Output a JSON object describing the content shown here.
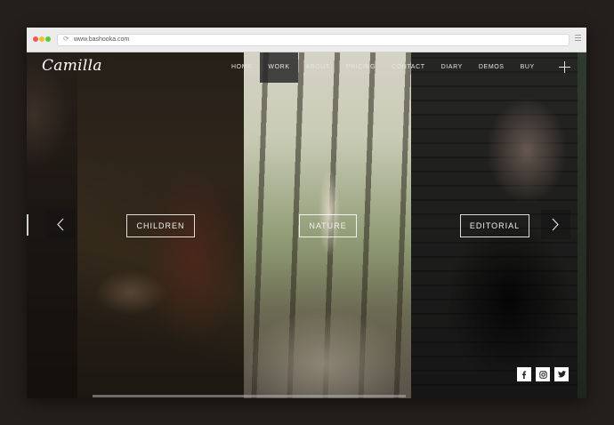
{
  "browser": {
    "url": "www.bashooka.com"
  },
  "site": {
    "logo": "Camilla",
    "nav": [
      {
        "label": "HOME",
        "active": false
      },
      {
        "label": "WORK",
        "active": true
      },
      {
        "label": "ABOUT",
        "active": false
      },
      {
        "label": "PRICING",
        "active": false
      },
      {
        "label": "CONTACT",
        "active": false
      },
      {
        "label": "DIARY",
        "active": false
      },
      {
        "label": "DEMOS",
        "active": false
      },
      {
        "label": "BUY",
        "active": false
      }
    ]
  },
  "categories": [
    {
      "label": "CHILDREN"
    },
    {
      "label": "NATURE"
    },
    {
      "label": "EDITORIAL"
    }
  ],
  "social": [
    "facebook-icon",
    "instagram-icon",
    "twitter-icon"
  ],
  "colors": {
    "page_background": "#241f1c",
    "browser_chrome": "#ececec",
    "nav_text": "#e4e4e4"
  },
  "slider": {
    "progress": 0.56
  }
}
